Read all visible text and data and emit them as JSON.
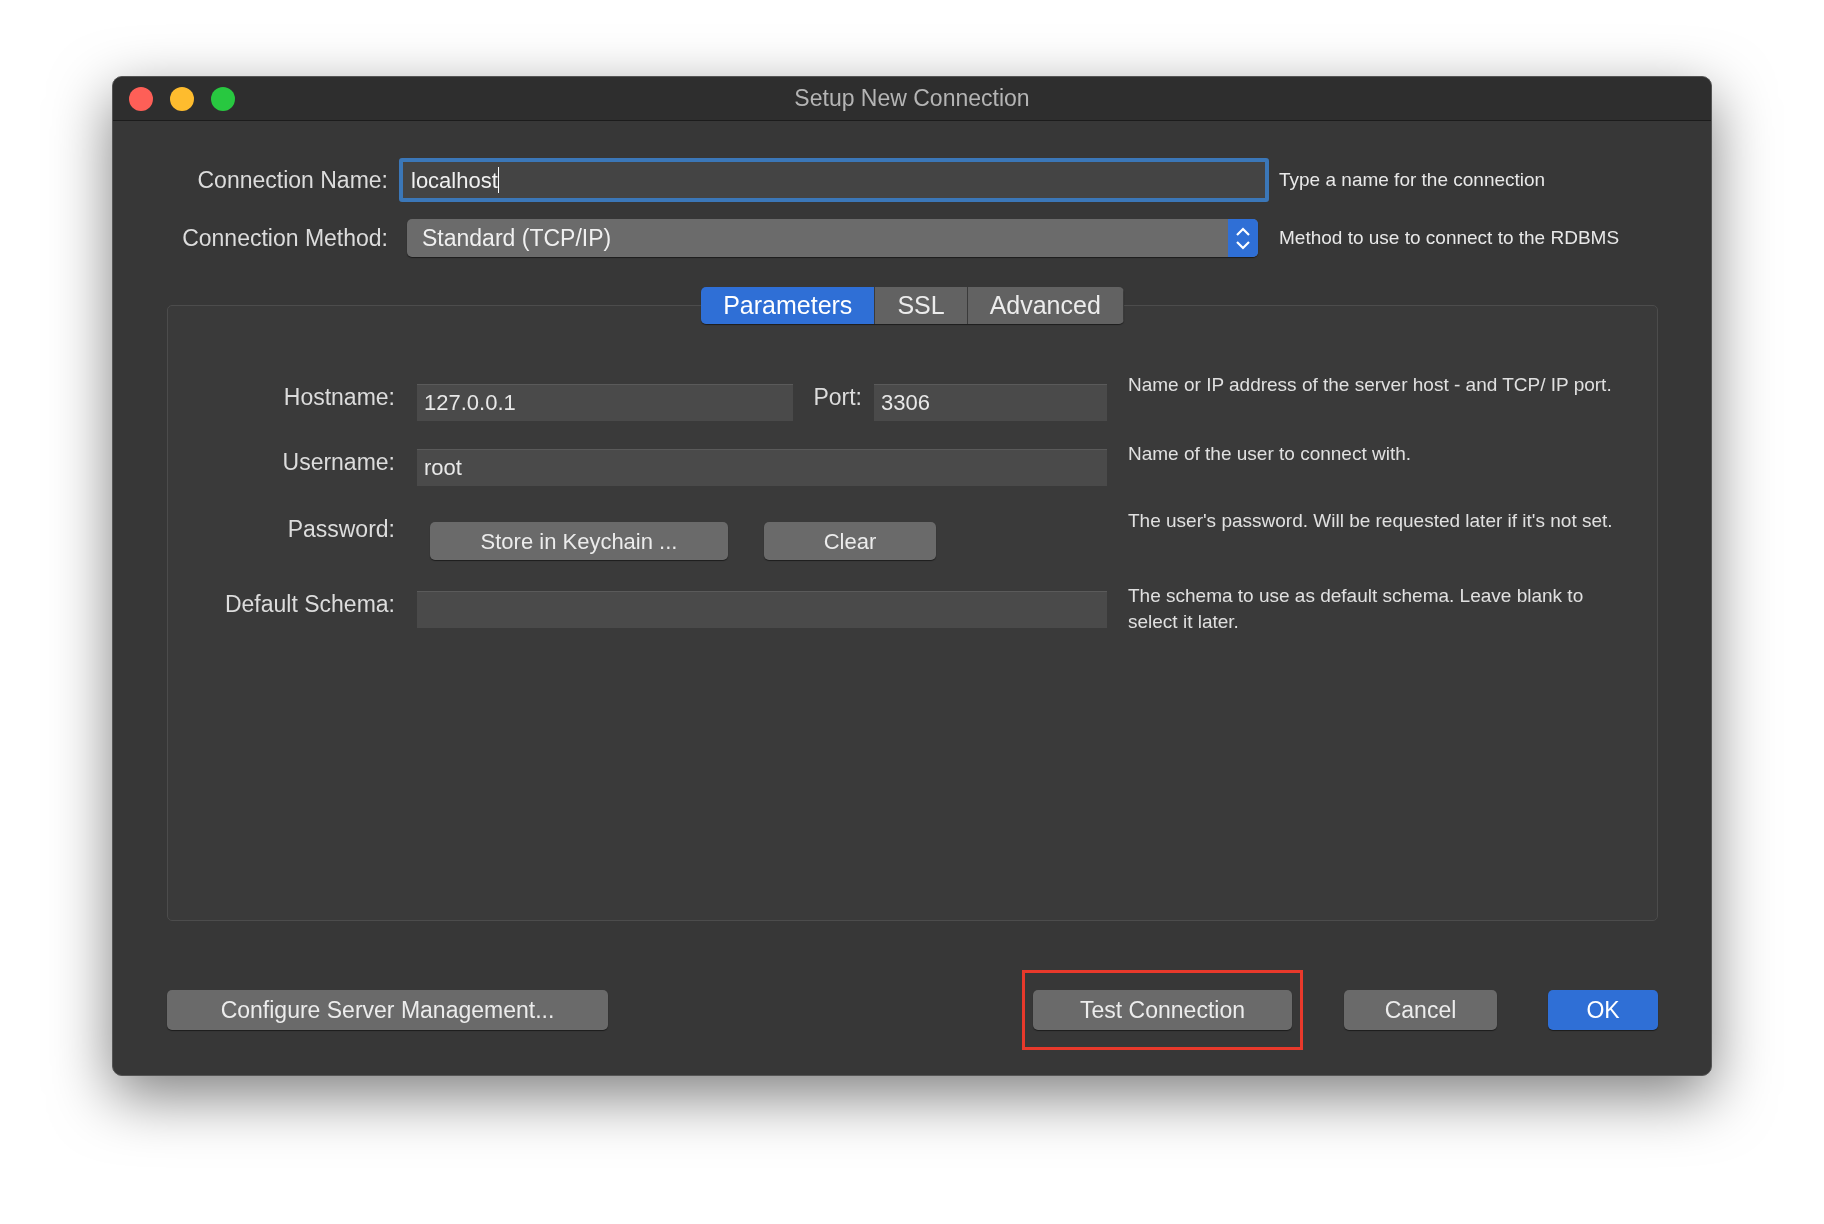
{
  "window": {
    "title": "Setup New Connection"
  },
  "connection_name": {
    "label": "Connection Name:",
    "value": "localhost",
    "focused": true,
    "hint": "Type a name for the connection"
  },
  "connection_method": {
    "label": "Connection Method:",
    "value": "Standard (TCP/IP)",
    "hint": "Method to use to connect to the RDBMS"
  },
  "tabs": [
    {
      "label": "Parameters",
      "selected": true
    },
    {
      "label": "SSL",
      "selected": false
    },
    {
      "label": "Advanced",
      "selected": false
    }
  ],
  "parameters": {
    "hostname": {
      "label": "Hostname:",
      "value": "127.0.0.1"
    },
    "port": {
      "label": "Port:",
      "value": "3306"
    },
    "host_hint": "Name or IP address of the server host - and TCP/ IP port.",
    "username": {
      "label": "Username:",
      "value": "root",
      "hint": "Name of the user to connect with."
    },
    "password": {
      "label": "Password:",
      "buttons": [
        "Store in Keychain ...",
        "Clear"
      ],
      "hint": "The user's password. Will be requested later if it's not set."
    },
    "default_schema": {
      "label": "Default Schema:",
      "hint": "The schema to use as default schema. Leave blank to select it later."
    }
  },
  "buttons": [
    {
      "label": "Configure Server Management...",
      "kind": "normal",
      "highlighted": false
    },
    {
      "label": "Test Connection",
      "kind": "normal",
      "highlighted": true
    },
    {
      "label": "Cancel",
      "kind": "normal",
      "highlighted": false
    },
    {
      "label": "OK",
      "kind": "default",
      "highlighted": false
    }
  ]
}
